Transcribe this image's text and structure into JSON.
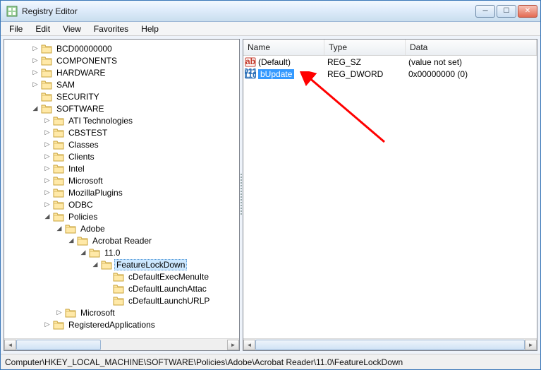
{
  "window": {
    "title": "Registry Editor"
  },
  "menu": {
    "file": "File",
    "edit": "Edit",
    "view": "View",
    "favorites": "Favorites",
    "help": "Help"
  },
  "tree": {
    "items": [
      {
        "indent": 2,
        "exp": "▷",
        "label": "BCD00000000"
      },
      {
        "indent": 2,
        "exp": "▷",
        "label": "COMPONENTS"
      },
      {
        "indent": 2,
        "exp": "▷",
        "label": "HARDWARE"
      },
      {
        "indent": 2,
        "exp": "▷",
        "label": "SAM"
      },
      {
        "indent": 2,
        "exp": "",
        "label": "SECURITY"
      },
      {
        "indent": 2,
        "exp": "◢",
        "label": "SOFTWARE"
      },
      {
        "indent": 3,
        "exp": "▷",
        "label": "ATI Technologies"
      },
      {
        "indent": 3,
        "exp": "▷",
        "label": "CBSTEST"
      },
      {
        "indent": 3,
        "exp": "▷",
        "label": "Classes"
      },
      {
        "indent": 3,
        "exp": "▷",
        "label": "Clients"
      },
      {
        "indent": 3,
        "exp": "▷",
        "label": "Intel"
      },
      {
        "indent": 3,
        "exp": "▷",
        "label": "Microsoft"
      },
      {
        "indent": 3,
        "exp": "▷",
        "label": "MozillaPlugins"
      },
      {
        "indent": 3,
        "exp": "▷",
        "label": "ODBC"
      },
      {
        "indent": 3,
        "exp": "◢",
        "label": "Policies"
      },
      {
        "indent": 4,
        "exp": "◢",
        "label": "Adobe"
      },
      {
        "indent": 5,
        "exp": "◢",
        "label": "Acrobat Reader"
      },
      {
        "indent": 6,
        "exp": "◢",
        "label": "11.0"
      },
      {
        "indent": 7,
        "exp": "◢",
        "label": "FeatureLockDown",
        "selected": true
      },
      {
        "indent": 8,
        "exp": "",
        "label": "cDefaultExecMenuIte"
      },
      {
        "indent": 8,
        "exp": "",
        "label": "cDefaultLaunchAttac"
      },
      {
        "indent": 8,
        "exp": "",
        "label": "cDefaultLaunchURLP"
      },
      {
        "indent": 4,
        "exp": "▷",
        "label": "Microsoft"
      },
      {
        "indent": 3,
        "exp": "▷",
        "label": "RegisteredApplications"
      }
    ]
  },
  "list": {
    "headers": {
      "name": "Name",
      "type": "Type",
      "data": "Data"
    },
    "rows": [
      {
        "icon": "sz",
        "name": "(Default)",
        "type": "REG_SZ",
        "data": "(value not set)",
        "selected": false
      },
      {
        "icon": "dword",
        "name": "bUpdate",
        "type": "REG_DWORD",
        "data": "0x00000000 (0)",
        "selected": true
      }
    ]
  },
  "status": {
    "path": "Computer\\HKEY_LOCAL_MACHINE\\SOFTWARE\\Policies\\Adobe\\Acrobat Reader\\11.0\\FeatureLockDown"
  }
}
